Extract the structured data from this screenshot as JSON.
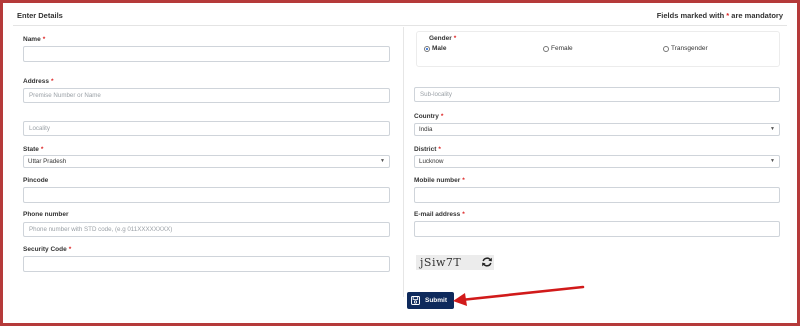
{
  "header": {
    "title": "Enter Details",
    "note_prefix": "Fields marked with ",
    "note_star": "*",
    "note_suffix": " are mandatory"
  },
  "form": {
    "name": {
      "label": "Name",
      "req": "*",
      "value": ""
    },
    "gender": {
      "label": "Gender",
      "req": "*",
      "options": [
        {
          "label": "Male",
          "checked": true
        },
        {
          "label": "Female",
          "checked": false
        },
        {
          "label": "Transgender",
          "checked": false
        }
      ]
    },
    "address": {
      "label": "Address",
      "req": "*",
      "premise_placeholder": "Premise Number or Name",
      "sublocality_placeholder": "Sub-locality",
      "locality_placeholder": "Locality"
    },
    "country": {
      "label": "Country",
      "req": "*",
      "value": "India"
    },
    "state": {
      "label": "State",
      "req": "*",
      "value": "Uttar Pradesh"
    },
    "district": {
      "label": "District",
      "req": "*",
      "value": "Lucknow"
    },
    "pincode": {
      "label": "Pincode",
      "value": ""
    },
    "mobile": {
      "label": "Mobile number",
      "req": "*",
      "value": ""
    },
    "phone": {
      "label": "Phone number",
      "placeholder": "Phone number with STD code, (e.g 011XXXXXXXX)"
    },
    "email": {
      "label": "E-mail address",
      "req": "*",
      "value": ""
    },
    "security": {
      "label": "Security Code",
      "req": "*",
      "value": "",
      "captcha_text": "jSiw7T"
    },
    "submit_label": "Submit"
  },
  "colors": {
    "frame": "#b53a3a",
    "button": "#0e2a5c",
    "arrow": "#d11a1a",
    "required": "#dd2222"
  },
  "icons": {
    "save": "save-icon",
    "refresh": "refresh-icon",
    "caret": "caret-down-icon"
  }
}
